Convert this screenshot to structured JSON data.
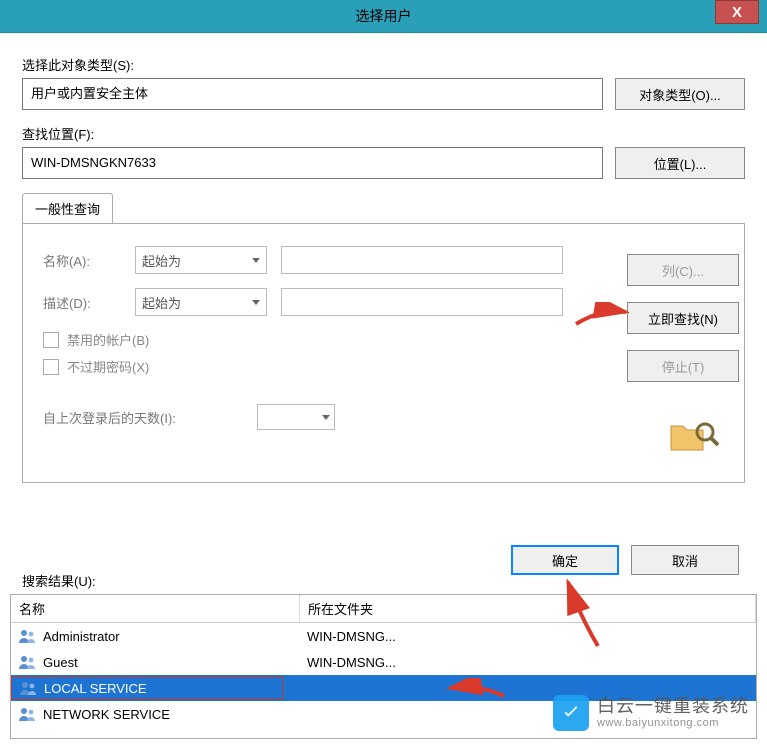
{
  "title": "选择用户",
  "close_glyph": "X",
  "labels": {
    "object_type": "选择此对象类型(S):",
    "location": "查找位置(F):",
    "tab_general": "一般性查询",
    "name": "名称(A):",
    "description": "描述(D):",
    "disabled_accounts": "禁用的帐户(B)",
    "non_expiring_pw": "不过期密码(X)",
    "days_since_login": "自上次登录后的天数(I):",
    "search_results": "搜索结果(U):",
    "col_name": "名称",
    "col_folder": "所在文件夹"
  },
  "fields": {
    "object_type_value": "用户或内置安全主体",
    "location_value": "WIN-DMSNGKN7633",
    "name_match": "起始为",
    "desc_match": "起始为"
  },
  "buttons": {
    "object_types": "对象类型(O)...",
    "locations": "位置(L)...",
    "columns": "列(C)...",
    "find_now": "立即查找(N)",
    "stop": "停止(T)",
    "ok": "确定",
    "cancel": "取消"
  },
  "results": [
    {
      "name": "Administrator",
      "folder": "WIN-DMSNG..."
    },
    {
      "name": "Guest",
      "folder": "WIN-DMSNG..."
    },
    {
      "name": "LOCAL SERVICE",
      "folder": ""
    },
    {
      "name": "NETWORK SERVICE",
      "folder": ""
    }
  ],
  "selected_index": 2,
  "watermark": {
    "cn": "白云一键重装系统",
    "en": "www.baiyunxitong.com"
  }
}
